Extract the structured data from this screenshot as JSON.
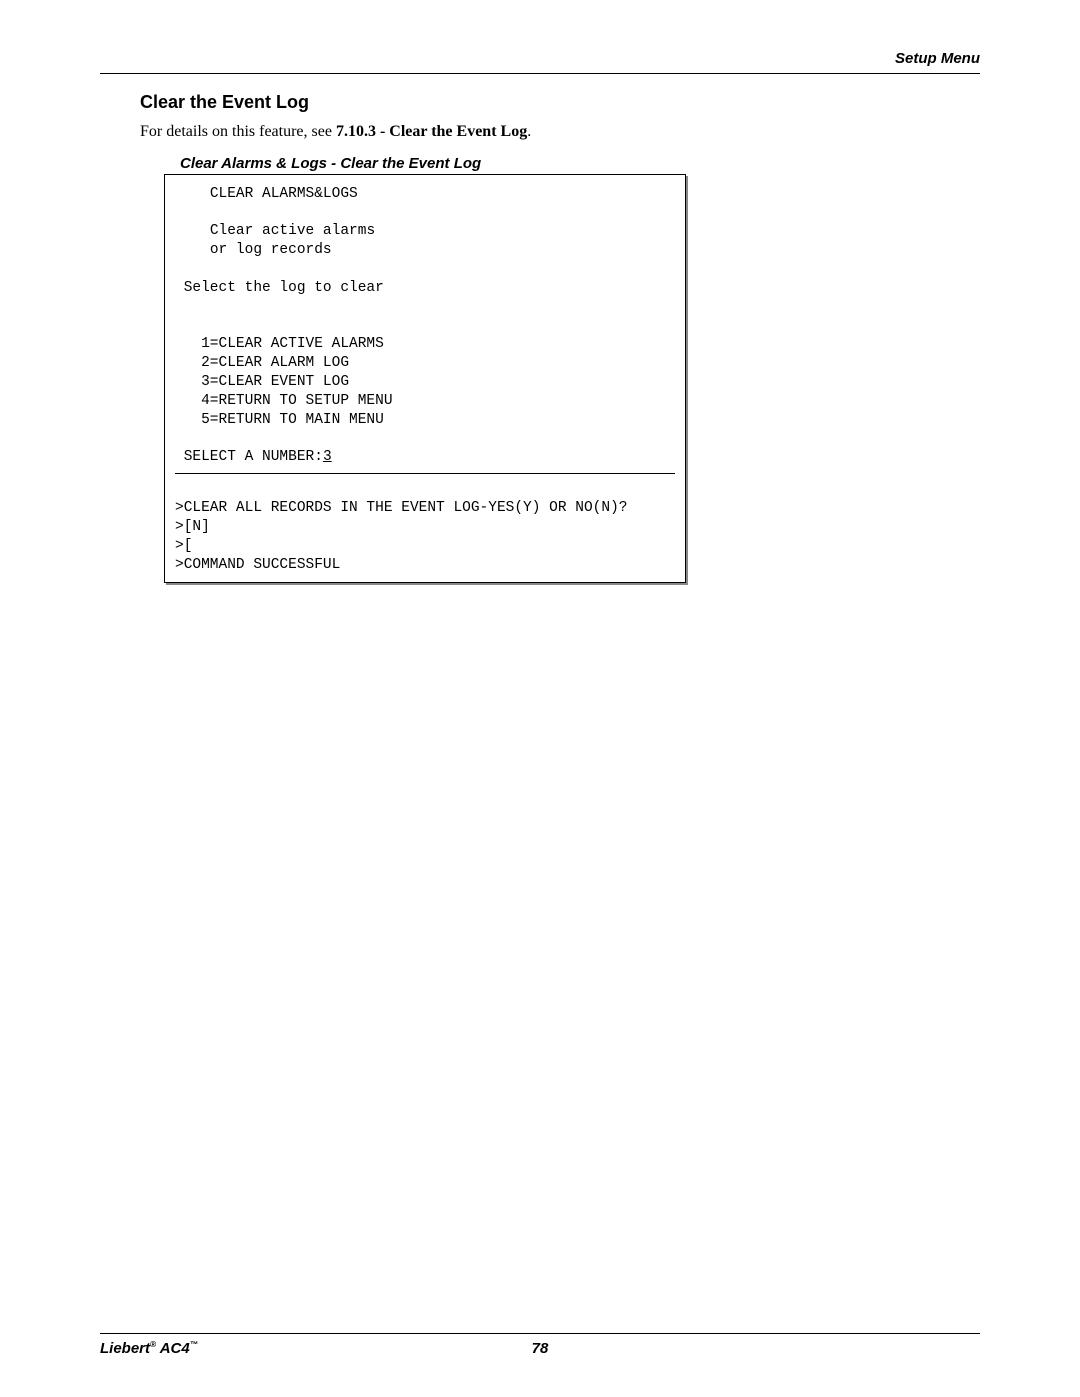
{
  "header": {
    "right": "Setup Menu"
  },
  "section": {
    "title": "Clear the Event Log",
    "intro_prefix": "For details on this feature, see ",
    "intro_ref": "7.10.3 - Clear the Event Log",
    "intro_suffix": "."
  },
  "panel": {
    "caption": "Clear Alarms & Logs - Clear the Event Log",
    "top_header": "CLEAR ALARMS&LOGS",
    "top_desc1": "Clear active alarms",
    "top_desc2": "or log records",
    "select_prompt": "Select the log to clear",
    "options": [
      "1=CLEAR ACTIVE ALARMS",
      "2=CLEAR ALARM LOG",
      "3=CLEAR EVENT LOG",
      "4=RETURN TO SETUP MENU",
      "5=RETURN TO MAIN MENU"
    ],
    "select_number_label": "SELECT A NUMBER:",
    "select_number_value": "3",
    "confirm_line": ">CLEAR ALL RECORDS IN THE EVENT LOG-YES(Y) OR NO(N)?",
    "input_default": ">[N]",
    "input_blank": ">[",
    "result_line": ">COMMAND SUCCESSFUL"
  },
  "footer": {
    "left_brand": "Liebert",
    "left_reg": "®",
    "left_model": " AC4",
    "left_tm": "™",
    "page_number": "78"
  }
}
